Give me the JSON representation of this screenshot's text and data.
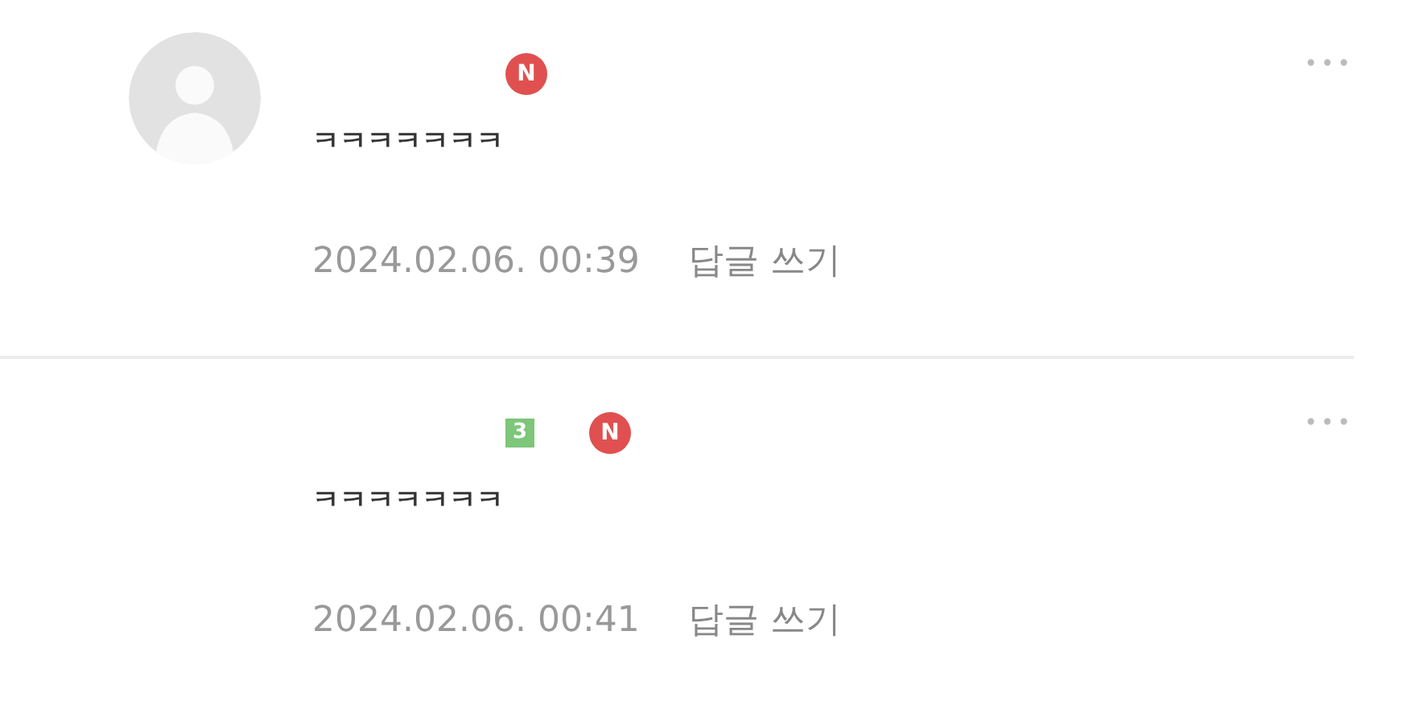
{
  "comments": [
    {
      "avatar": true,
      "badges": [
        {
          "kind": "new",
          "text": "N"
        }
      ],
      "text": "ㅋㅋㅋㅋㅋㅋㅋ",
      "date": "2024.02.06. 00:39",
      "reply": "답글 쓰기",
      "more": "•••"
    },
    {
      "avatar": false,
      "badges": [
        {
          "kind": "level",
          "text": "3"
        },
        {
          "kind": "new",
          "text": "N"
        }
      ],
      "text": "ㅋㅋㅋㅋㅋㅋㅋ",
      "date": "2024.02.06. 00:41",
      "reply": "답글 쓰기",
      "more": "•••"
    }
  ]
}
